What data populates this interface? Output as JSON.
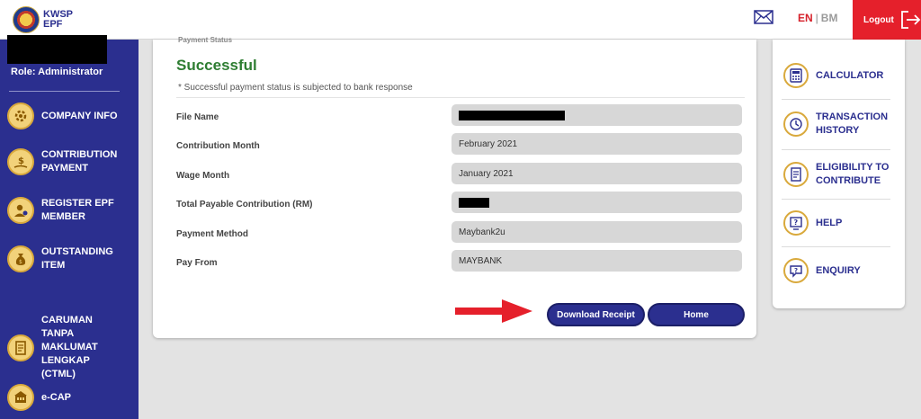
{
  "header": {
    "logo_line1": "KWSP",
    "logo_line2": "EPF",
    "lang_en": "EN",
    "lang_sep": "|",
    "lang_bm": "BM",
    "logout_label": "Logout"
  },
  "sidebar": {
    "role": "Role: Administrator",
    "items": [
      {
        "label": "COMPANY INFO",
        "icon": "gear-icon"
      },
      {
        "label": "CONTRIBUTION PAYMENT",
        "icon": "money-hand-icon"
      },
      {
        "label": "REGISTER EPF MEMBER",
        "icon": "user-add-icon"
      },
      {
        "label": "OUTSTANDING ITEM",
        "icon": "money-bag-icon"
      },
      {
        "label": "CARUMAN TANPA MAKLUMAT LENGKAP (CTML)",
        "icon": "document-icon"
      },
      {
        "label": "e-CAP",
        "icon": "building-icon"
      }
    ]
  },
  "main": {
    "cut_heading": "Payment Status",
    "status_title": "Successful",
    "status_note": "* Successful payment status is subjected to bank response",
    "rows": [
      {
        "label": "File Name",
        "value": ""
      },
      {
        "label": "Contribution Month",
        "value": "February 2021"
      },
      {
        "label": "Wage Month",
        "value": "January 2021"
      },
      {
        "label": "Total Payable Contribution (RM)",
        "value": ""
      },
      {
        "label": "Payment Method",
        "value": "Maybank2u"
      },
      {
        "label": "Pay From",
        "value": "MAYBANK"
      }
    ],
    "download_button": "Download Receipt",
    "home_button": "Home"
  },
  "right_panel": {
    "items": [
      {
        "label": "CALCULATOR",
        "icon": "calculator-icon"
      },
      {
        "label": "TRANSACTION HISTORY",
        "icon": "history-icon"
      },
      {
        "label": "ELIGIBILITY TO CONTRIBUTE",
        "icon": "checklist-icon"
      },
      {
        "label": "HELP",
        "icon": "help-icon"
      },
      {
        "label": "ENQUIRY",
        "icon": "enquiry-icon"
      }
    ]
  },
  "colors": {
    "brand_blue": "#2b2f8f",
    "accent_red": "#e5202b",
    "success_green": "#2e7d32",
    "icon_gold": "#d9a93c"
  }
}
